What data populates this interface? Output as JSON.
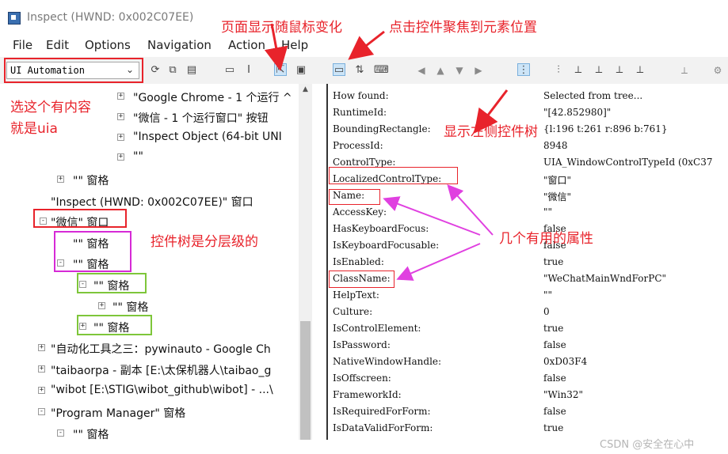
{
  "window": {
    "title": "Inspect  (HWND: 0x002C07EE)",
    "app_icon": "inspect-app-icon"
  },
  "menubar": [
    "File",
    "Edit",
    "Options",
    "Navigation",
    "Action",
    "Help"
  ],
  "toolbar": {
    "mode_value": "UI Automation",
    "caret": "⌄"
  },
  "tree": {
    "nodes": [
      {
        "text": "\"Google Chrome - 1 个运行 ^",
        "exp": "+"
      },
      {
        "text": "\"微信 - 1 个运行窗口\" 按钮",
        "exp": "+"
      },
      {
        "text": "\"Inspect Object (64-bit UNI",
        "exp": "+"
      },
      {
        "text": "\"\"",
        "exp": "+"
      },
      {
        "text": "\"\" 窗格",
        "exp": "+"
      },
      {
        "text": "\"Inspect  (HWND: 0x002C07EE)\" 窗口",
        "exp": ""
      },
      {
        "text": "\"微信\" 窗口",
        "exp": "-"
      },
      {
        "text": "\"\" 窗格",
        "exp": ""
      },
      {
        "text": "\"\" 窗格",
        "exp": "-"
      },
      {
        "text": "\"\" 窗格",
        "exp": "-"
      },
      {
        "text": "\"\" 窗格",
        "exp": "+"
      },
      {
        "text": "\"\" 窗格",
        "exp": "+"
      },
      {
        "text": "\"自动化工具之三：pywinauto - Google Ch",
        "exp": "+"
      },
      {
        "text": "\"taibaorpa - 副本 [E:\\太保机器人\\taibao_g",
        "exp": "+"
      },
      {
        "text": "\"wibot [E:\\STIG\\wibot_github\\wibot] - ...\\",
        "exp": "+"
      },
      {
        "text": "\"Program Manager\" 窗格",
        "exp": "-"
      },
      {
        "text": "\"\" 窗格",
        "exp": "-"
      }
    ]
  },
  "properties": [
    {
      "name": "How found:",
      "value": "Selected from tree..."
    },
    {
      "name": "RuntimeId:",
      "value": "\"[42.852980]\""
    },
    {
      "name": "BoundingRectangle:",
      "value": "{l:196 t:261 r:896 b:761}"
    },
    {
      "name": "ProcessId:",
      "value": "8948"
    },
    {
      "name": "ControlType:",
      "value": "UIA_WindowControlTypeId (0xC37"
    },
    {
      "name": "LocalizedControlType:",
      "value": "\"窗口\""
    },
    {
      "name": "Name:",
      "value": "\"微信\""
    },
    {
      "name": "AccessKey:",
      "value": "\"\""
    },
    {
      "name": "HasKeyboardFocus:",
      "value": "false"
    },
    {
      "name": "IsKeyboardFocusable:",
      "value": "false"
    },
    {
      "name": "IsEnabled:",
      "value": "true"
    },
    {
      "name": "ClassName:",
      "value": "\"WeChatMainWndForPC\""
    },
    {
      "name": "HelpText:",
      "value": "\"\""
    },
    {
      "name": "Culture:",
      "value": "0"
    },
    {
      "name": "IsControlElement:",
      "value": "true"
    },
    {
      "name": "IsPassword:",
      "value": "false"
    },
    {
      "name": "NativeWindowHandle:",
      "value": "0xD03F4"
    },
    {
      "name": "IsOffscreen:",
      "value": "false"
    },
    {
      "name": "FrameworkId:",
      "value": "\"Win32\""
    },
    {
      "name": "IsRequiredForForm:",
      "value": "false"
    },
    {
      "name": "IsDataValidForForm:",
      "value": "true"
    }
  ],
  "annotations": {
    "page_follows_mouse": "页面显示随鼠标变化",
    "click_focus": "点击控件聚焦到元素位置",
    "select_uia_1": "选这个有内容",
    "select_uia_2": "就是uia",
    "show_tree_control": "显示左侧控件树",
    "tree_hierarchical": "控件树是分层级的",
    "useful_properties": "几个有用的属性"
  },
  "colors": {
    "annotation_red": "#e8232b",
    "arrow_magenta": "#e040e0",
    "box_magenta": "#d62ad6",
    "box_green": "#7ec63a"
  },
  "watermark": "CSDN @安全在心中"
}
